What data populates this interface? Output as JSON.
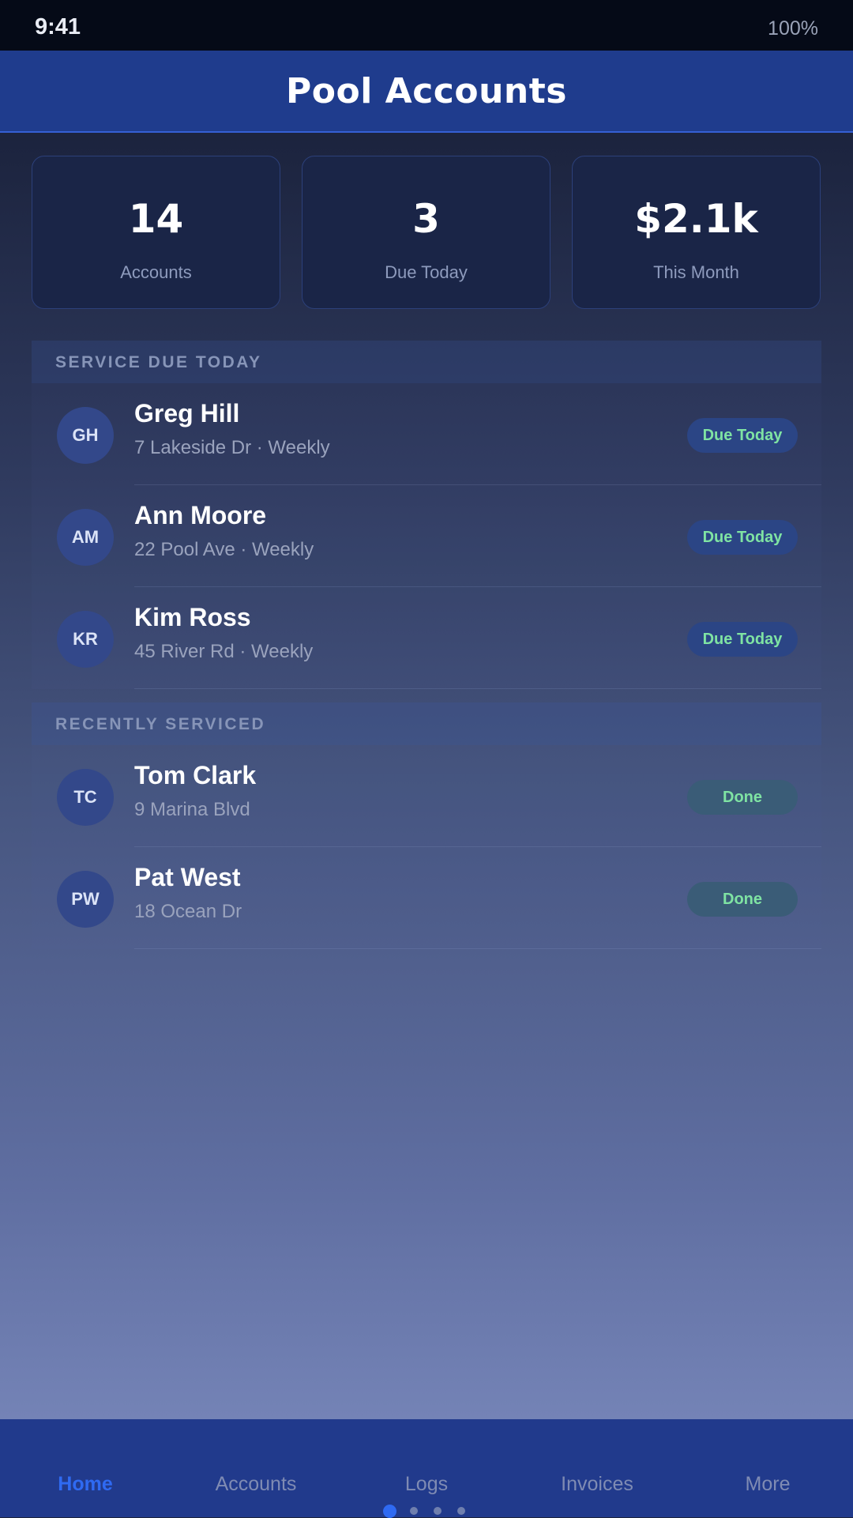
{
  "status_bar": {
    "time": "9:41",
    "battery": "100%"
  },
  "header": {
    "title": "Pool Accounts"
  },
  "stats": [
    {
      "value": "14",
      "label": "Accounts"
    },
    {
      "value": "3",
      "label": "Due Today"
    },
    {
      "value": "$2.1k",
      "label": "This Month"
    }
  ],
  "due_section": {
    "title": "SERVICE DUE TODAY",
    "rows": [
      {
        "initials": "GH",
        "name": "Greg Hill",
        "subtitle": "7 Lakeside Dr · Weekly",
        "badge": "Due Today"
      },
      {
        "initials": "AM",
        "name": "Ann Moore",
        "subtitle": "22 Pool Ave · Weekly",
        "badge": "Due Today"
      },
      {
        "initials": "KR",
        "name": "Kim Ross",
        "subtitle": "45 River Rd · Weekly",
        "badge": "Due Today"
      }
    ]
  },
  "recent_section": {
    "title": "RECENTLY SERVICED",
    "rows": [
      {
        "initials": "TC",
        "name": "Tom Clark",
        "subtitle": "9 Marina Blvd",
        "badge": "Done"
      },
      {
        "initials": "PW",
        "name": "Pat West",
        "subtitle": "18 Ocean Dr",
        "badge": "Done"
      }
    ]
  },
  "bottom_nav": {
    "items": [
      {
        "label": "Home",
        "active": true
      },
      {
        "label": "Accounts",
        "active": false
      },
      {
        "label": "Logs",
        "active": false
      },
      {
        "label": "Invoices",
        "active": false
      },
      {
        "label": "More",
        "active": false
      }
    ]
  },
  "page_indicator": {
    "pages": 4,
    "current": 1
  },
  "colors": {
    "accent": "#2f6af2",
    "header_bg": "#1f3c8d",
    "status_green": "#7fe3a3"
  }
}
